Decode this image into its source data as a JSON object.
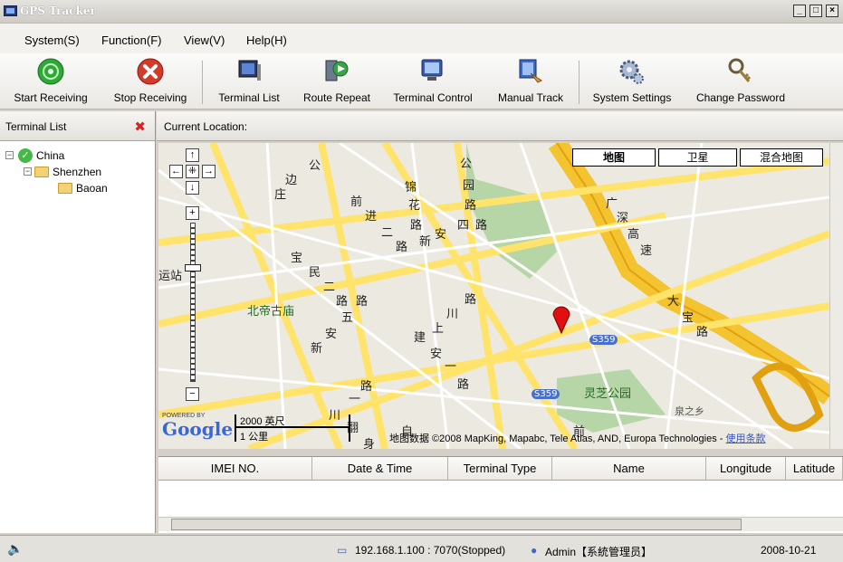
{
  "window": {
    "title": "GPS Tracker",
    "minimize": "_",
    "maximize": "□",
    "close": "×"
  },
  "menu": [
    "System(S)",
    "Function(F)",
    "View(V)",
    "Help(H)"
  ],
  "toolbar": [
    {
      "label": "Start Receiving",
      "icon": "start-receiving-icon",
      "color": "#2fa83a"
    },
    {
      "label": "Stop Receiving",
      "icon": "stop-receiving-icon",
      "color": "#d33a2a"
    },
    {
      "label": "Terminal List",
      "icon": "terminal-list-icon",
      "color": "#3a5a9a"
    },
    {
      "label": "Route Repeat",
      "icon": "route-repeat-icon",
      "color": "#3aa24a"
    },
    {
      "label": "Terminal Control",
      "icon": "terminal-control-icon",
      "color": "#3a6ac8"
    },
    {
      "label": "Manual Track",
      "icon": "manual-track-icon",
      "color": "#3a6ac8"
    },
    {
      "label": "System Settings",
      "icon": "gear-icon",
      "color": "#7a8aa8"
    },
    {
      "label": "Change Password",
      "icon": "key-icon",
      "color": "#9a7a3a"
    }
  ],
  "left_panel": {
    "title": "Terminal List",
    "close": "✖",
    "tree": [
      {
        "label": "China",
        "level": 0
      },
      {
        "label": "Shenzhen",
        "level": 1
      },
      {
        "label": "Baoan",
        "level": 2
      }
    ]
  },
  "main": {
    "location_label": "Current Location:",
    "map_types": [
      "地图",
      "卫星",
      "混合地图"
    ],
    "map_labels": [
      "公",
      "园",
      "锦",
      "花",
      "路",
      "四",
      "路",
      "路",
      "新",
      "安",
      "前",
      "进",
      "二",
      "路",
      "宝",
      "民",
      "二",
      "路",
      "路",
      "五",
      "新",
      "安",
      "北帝古庙",
      "上",
      "川",
      "建",
      "上",
      "安",
      "一",
      "路",
      "路",
      "广",
      "深",
      "高",
      "速",
      "大",
      "宝",
      "路",
      "灵芝公园",
      "泉之乡",
      "S359",
      "S359",
      "运站",
      "边",
      "庄",
      "路",
      "川",
      "翻",
      "身",
      "自",
      "前"
    ],
    "scale": [
      "2000 英尺",
      "1 公里"
    ],
    "powered_by": "POWERED BY",
    "google": "Google",
    "copyright": "地图数据 ©2008 MapKing, Mapabc, Tele Atlas, AND, Europa Technologies - ",
    "terms_link": "使用条款",
    "controls": [
      "↑",
      "←",
      "⁜",
      "→",
      "↓",
      "+",
      "−"
    ]
  },
  "grid": {
    "columns": [
      "IMEI NO.",
      "Date & Time",
      "Terminal Type",
      "Name",
      "Longitude",
      "Latitude"
    ]
  },
  "status": {
    "server": "192.168.1.100 : 7070(Stopped)",
    "user": "Admin【系統管理员】",
    "date": "2008-10-21"
  }
}
